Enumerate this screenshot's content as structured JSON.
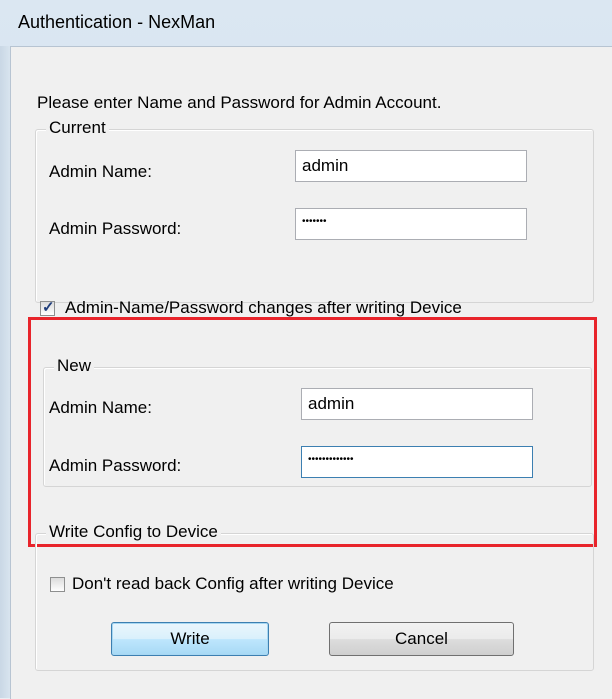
{
  "window": {
    "title": "Authentication - NexMan"
  },
  "instruction": "Please enter Name and Password for Admin Account.",
  "current": {
    "legend": "Current",
    "name_label": "Admin Name:",
    "name_value": "admin",
    "password_label": "Admin Password:",
    "password_value": "•••••••"
  },
  "change_option": {
    "label": "Admin-Name/Password changes after writing Device",
    "checked": true
  },
  "new": {
    "legend": "New",
    "name_label": "Admin Name:",
    "name_value": "admin",
    "password_label": "Admin Password:",
    "password_value": "•••••••••••••"
  },
  "write_config": {
    "legend": "Write Config to Device",
    "checkbox_label": "Don't read back Config after writing Device",
    "checked": false
  },
  "buttons": {
    "write": "Write",
    "cancel": "Cancel"
  },
  "colors": {
    "highlight": "#e8242b",
    "focus_border": "#3c7fb1"
  }
}
